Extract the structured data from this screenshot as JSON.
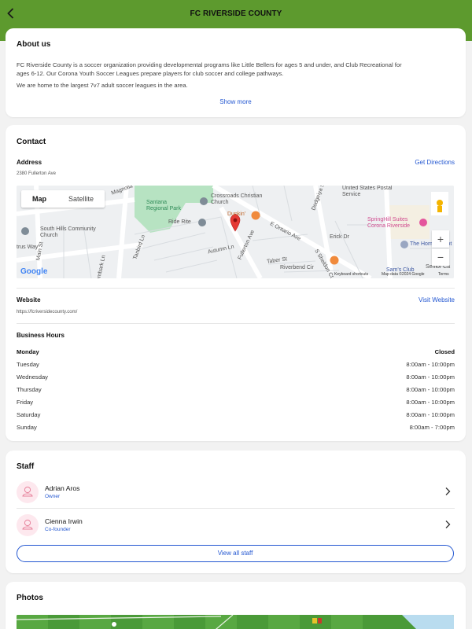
{
  "header": {
    "title": "FC RIVERSIDE COUNTY"
  },
  "about": {
    "title": "About us",
    "paragraph1_line1": "FC Riverside County is a soccer organization providing developmental programs like Little Bellers for ages 5 and under, and Club Recreational for",
    "paragraph1_line2": "ages 6-12. Our Corona Youth Soccer Leagues prepare players for club soccer and college pathways.",
    "paragraph2": "We are home to the largest 7v7 adult soccer leagues in the area.",
    "show_more": "Show more"
  },
  "contact": {
    "title": "Contact",
    "address_label": "Address",
    "address_value": "2380 Fullerton Ave",
    "directions": "Get Directions",
    "map": {
      "tabs": [
        "Map",
        "Satellite"
      ],
      "labels": {
        "magnolia": "Magnolia",
        "santana": "Santana Regional Park",
        "crossroads": "Crossroads Christian Church",
        "south_hills": "South Hills Community Church",
        "ride_rite": "Ride Rite",
        "dunkin": "Dunkin'",
        "ontario": "E Ontario Ave",
        "fullerton": "Fullerton Ave",
        "postal": "United States Postal Service",
        "springhill": "SpringHill Suites Corona Riverside",
        "home_depot": "The Home Depot",
        "erick": "Erick Dr",
        "taber": "Taber St",
        "riverbend": "Riverbend Cir",
        "autumn": "Autumn Ln",
        "main": "Main St",
        "tanbird": "Tanbird Ln",
        "trus": "trus Way",
        "sams": "Sam's Club",
        "senior": "Senior Ca",
        "gumbark": "Gumbark Ln",
        "dodgeiya": "Dodgeiya St",
        "sheldon": "S Sheldon Ct",
        "google": "Google",
        "keyboard": "Keyboard shortcuts",
        "mapdata": "Map data ©2024 Google",
        "terms": "Terms"
      },
      "zoom_in": "+",
      "zoom_out": "−"
    },
    "website_label": "Website",
    "website_value": "https://fcriversidecounty.com/",
    "visit": "Visit Website",
    "hours_label": "Business Hours",
    "hours": [
      {
        "day": "Monday",
        "time": "Closed"
      },
      {
        "day": "Tuesday",
        "time": "8:00am - 10:00pm"
      },
      {
        "day": "Wednesday",
        "time": "8:00am - 10:00pm"
      },
      {
        "day": "Thursday",
        "time": "8:00am - 10:00pm"
      },
      {
        "day": "Friday",
        "time": "8:00am - 10:00pm"
      },
      {
        "day": "Saturday",
        "time": "8:00am - 10:00pm"
      },
      {
        "day": "Sunday",
        "time": "8:00am - 7:00pm"
      }
    ]
  },
  "staff": {
    "title": "Staff",
    "members": [
      {
        "name": "Adrian Aros",
        "role": "Owner"
      },
      {
        "name": "Cienna Irwin",
        "role": "Co-founder"
      }
    ],
    "view_all": "View all staff"
  },
  "photos": {
    "title": "Photos"
  },
  "colors": {
    "brand_green": "#5d9a2e",
    "link_blue": "#2357d1",
    "marker_red": "#e53935"
  },
  "icons": {
    "back": "chevron-left-icon",
    "row": "chevron-right-icon",
    "avatar": "avatar-icon",
    "pin": "map-pin-icon"
  }
}
